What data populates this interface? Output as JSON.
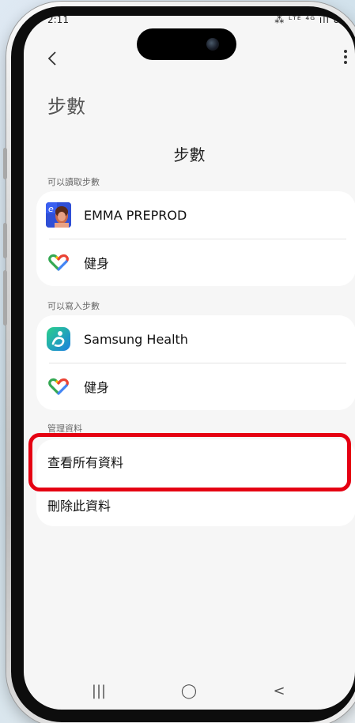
{
  "status_bar": {
    "time": "2:11",
    "icons_text": "⁂ ᴸᵀᴱ ⁴ᴳ ıll 83"
  },
  "header": {
    "page_heading": "步數",
    "title": "步數"
  },
  "sections": {
    "read": {
      "label": "可以讀取步數",
      "items": [
        {
          "label": "EMMA PREPROD",
          "icon": "emma-app-icon"
        },
        {
          "label": "健身",
          "icon": "google-fit-heart-icon"
        }
      ]
    },
    "write": {
      "label": "可以寫入步數",
      "items": [
        {
          "label": "Samsung Health",
          "icon": "samsung-health-icon"
        },
        {
          "label": "健身",
          "icon": "google-fit-heart-icon"
        }
      ]
    },
    "manage": {
      "label": "管理資料",
      "items": [
        {
          "label": "查看所有資料"
        },
        {
          "label": "刪除此資料"
        }
      ]
    }
  },
  "nav": {
    "recents": "|||",
    "home": "◯",
    "back": "<"
  },
  "colors": {
    "highlight": "#e50012",
    "screen_bg": "#f6f6f6",
    "card_bg": "#ffffff",
    "samsung_health_green": "#1eb37c",
    "samsung_health_blue": "#1a8fe0"
  }
}
